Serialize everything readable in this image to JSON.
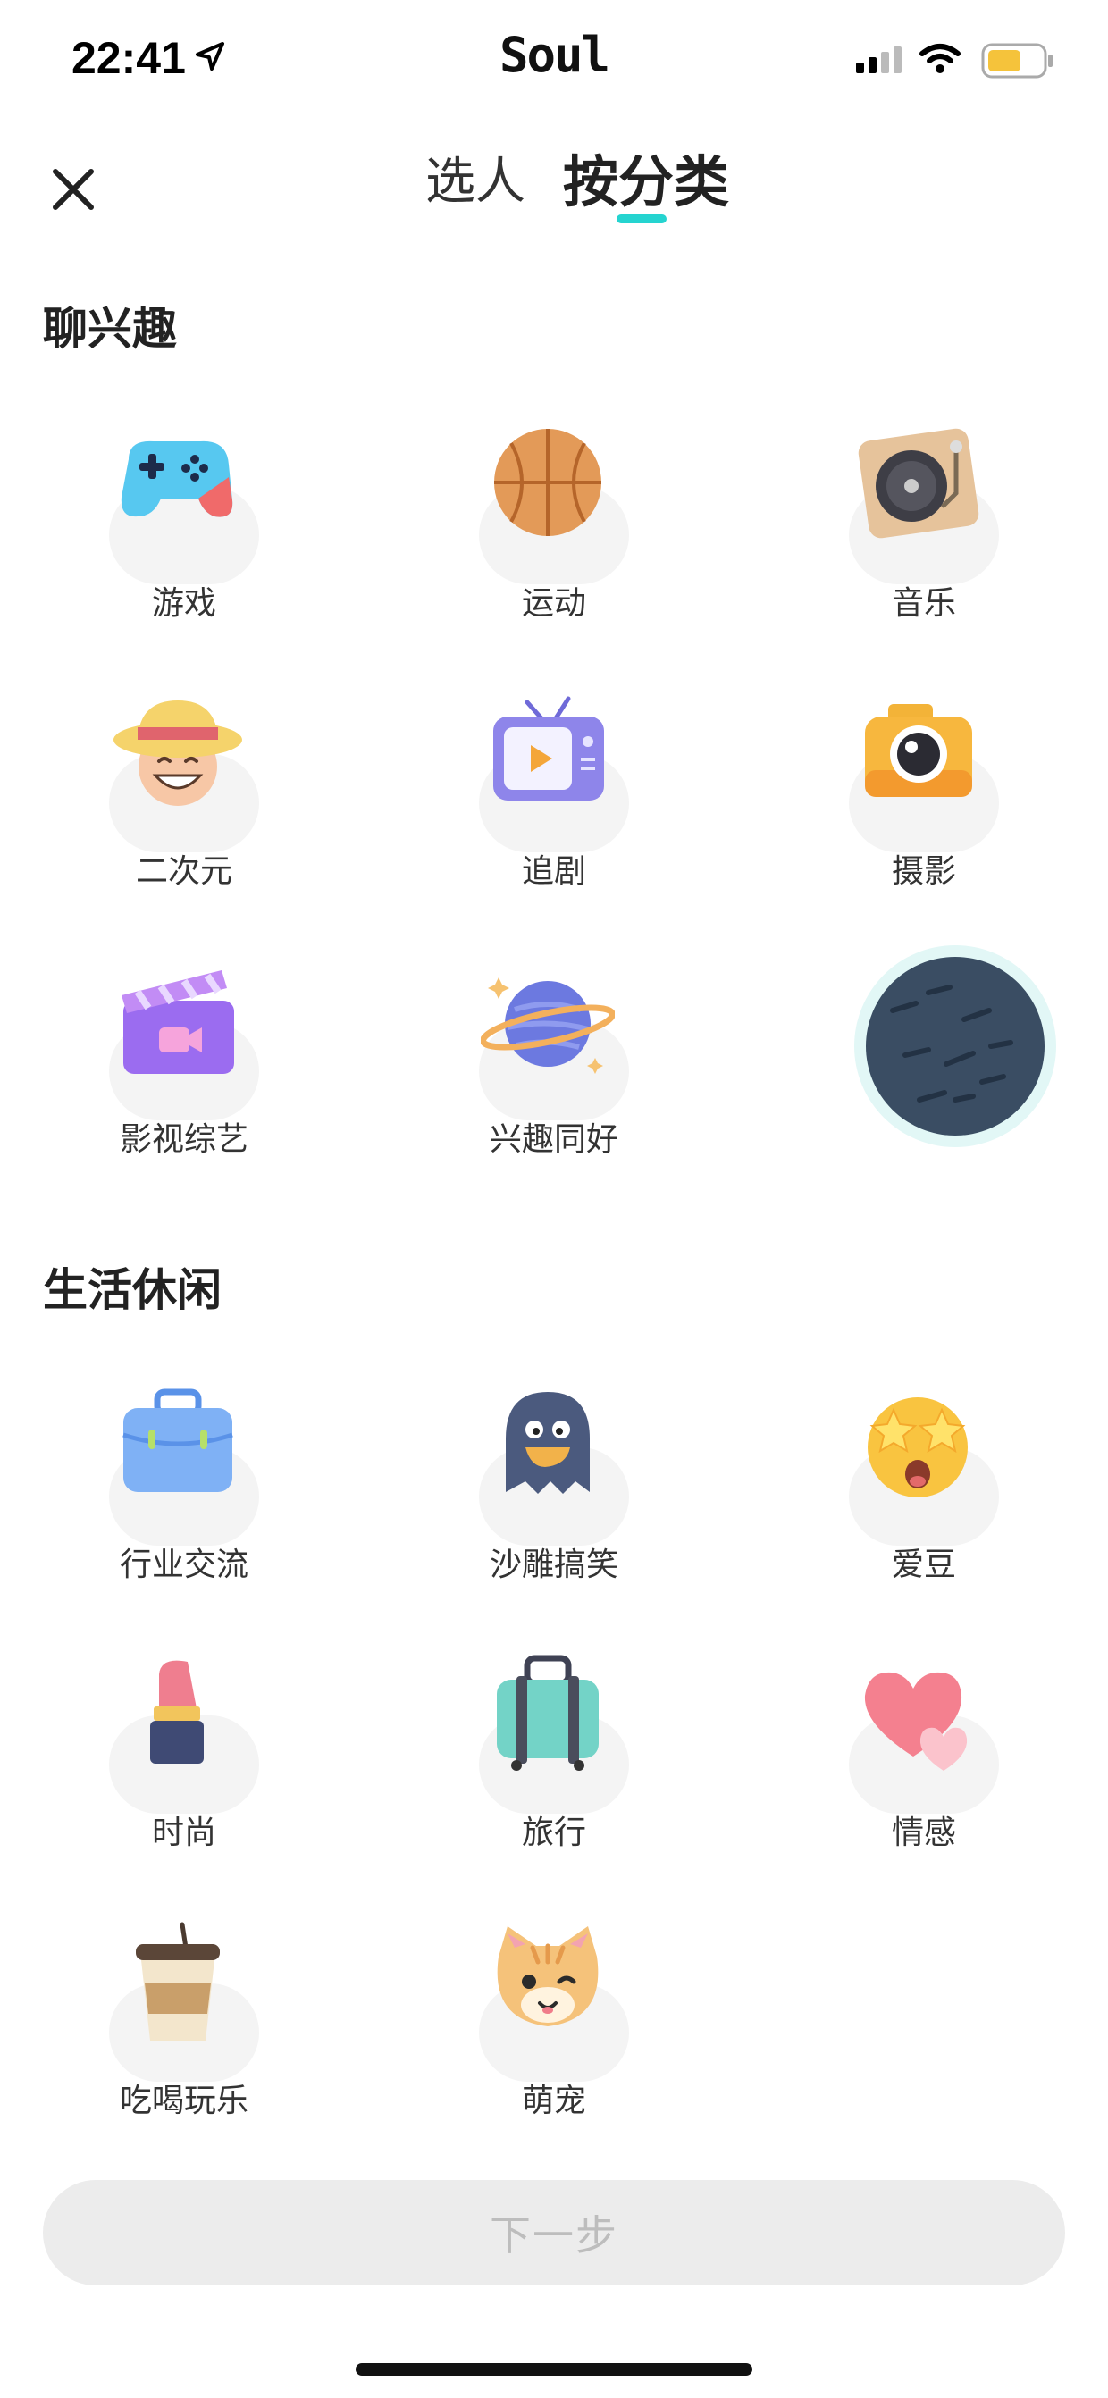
{
  "status_bar": {
    "time": "22:41",
    "app_name": "Soul"
  },
  "nav": {
    "tab_people": "选人",
    "tab_category": "按分类"
  },
  "sections": [
    {
      "title": "聊兴趣",
      "items": [
        {
          "label": "游戏",
          "icon": "gamepad-icon"
        },
        {
          "label": "运动",
          "icon": "basketball-icon"
        },
        {
          "label": "音乐",
          "icon": "turntable-icon"
        },
        {
          "label": "二次元",
          "icon": "strawhat-face-icon"
        },
        {
          "label": "追剧",
          "icon": "tv-icon"
        },
        {
          "label": "摄影",
          "icon": "camera-icon"
        },
        {
          "label": "影视综艺",
          "icon": "clapperboard-icon"
        },
        {
          "label": "兴趣同好",
          "icon": "planet-icon"
        }
      ]
    },
    {
      "title": "生活休闲",
      "items": [
        {
          "label": "行业交流",
          "icon": "briefcase-icon"
        },
        {
          "label": "沙雕搞笑",
          "icon": "ghost-duck-icon"
        },
        {
          "label": "爱豆",
          "icon": "star-eyes-emoji-icon"
        },
        {
          "label": "时尚",
          "icon": "lipstick-icon"
        },
        {
          "label": "旅行",
          "icon": "suitcase-icon"
        },
        {
          "label": "情感",
          "icon": "hearts-icon"
        },
        {
          "label": "吃喝玩乐",
          "icon": "coffee-cup-icon"
        },
        {
          "label": "萌宠",
          "icon": "cat-face-icon"
        }
      ]
    }
  ],
  "next_button": "下一步",
  "colors": {
    "accent": "#25d4d0",
    "button_bg": "#ececec",
    "button_text": "#bdbdbd"
  }
}
